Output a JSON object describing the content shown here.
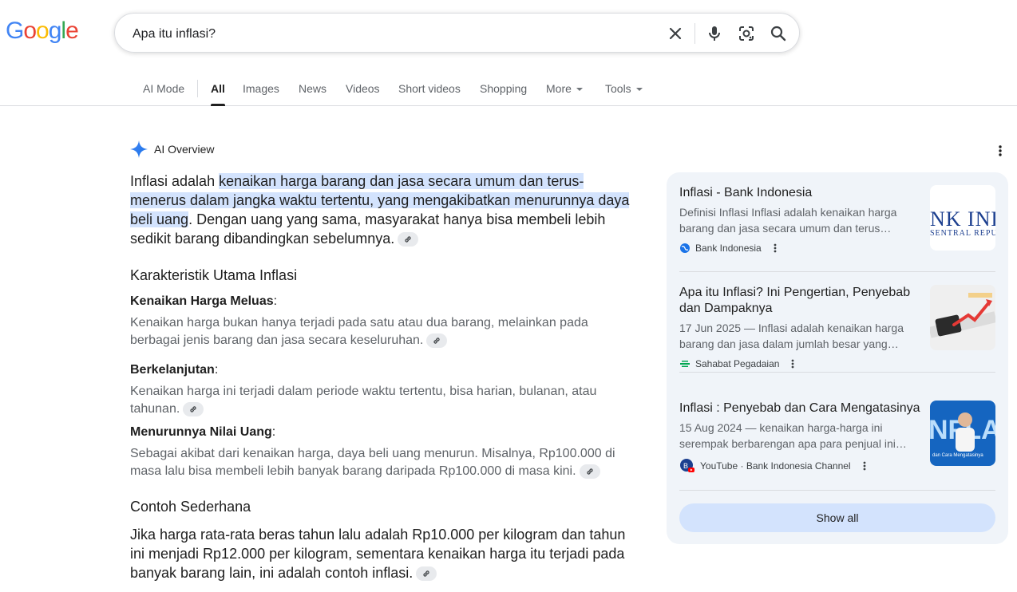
{
  "logo": {
    "letters": [
      "G",
      "o",
      "o",
      "g",
      "l",
      "e"
    ],
    "colors": [
      "#4285F4",
      "#EA4335",
      "#FBBC05",
      "#4285F4",
      "#34A853",
      "#EA4335"
    ]
  },
  "search": {
    "query": "Apa itu inflasi?"
  },
  "icons": {
    "clear": "close-icon",
    "voice": "mic-icon",
    "lens": "camera-lens-icon",
    "search": "search-icon"
  },
  "tabs": [
    {
      "label": "AI Mode"
    },
    {
      "label": "All",
      "active": true
    },
    {
      "label": "Images"
    },
    {
      "label": "News"
    },
    {
      "label": "Videos"
    },
    {
      "label": "Short videos"
    },
    {
      "label": "Shopping"
    },
    {
      "label": "More"
    },
    {
      "label": "Tools"
    }
  ],
  "ai_overview": {
    "title": "AI Overview",
    "intro": {
      "before": "Inflasi adalah ",
      "highlight": "kenaikan harga barang dan jasa secara umum dan terus-menerus dalam jangka waktu tertentu, yang mengakibatkan menurunnya daya beli uang",
      "after": ". Dengan uang yang sama, masyarakat hanya bisa membeli lebih sedikit barang dibandingkan sebelumnya."
    },
    "section1_heading": "Karakteristik Utama Inflasi",
    "items": [
      {
        "title": "Kenaikan Harga Meluas",
        "desc": "Kenaikan harga bukan hanya terjadi pada satu atau dua barang, melainkan pada berbagai jenis barang dan jasa secara keseluruhan."
      },
      {
        "title": "Berkelanjutan",
        "desc": "Kenaikan harga ini terjadi dalam periode waktu tertentu, bisa harian, bulanan, atau tahunan."
      },
      {
        "title": "Menurunnya Nilai Uang",
        "desc": "Sebagai akibat dari kenaikan harga, daya beli uang menurun. Misalnya, Rp100.000 di masa lalu bisa membeli lebih banyak barang daripada Rp100.000 di masa kini."
      }
    ],
    "section2_heading": "Contoh Sederhana",
    "example": "Jika harga rata-rata beras tahun lalu adalah Rp10.000 per kilogram dan tahun ini menjadi Rp12.000 per kilogram, sementara kenaikan harga itu terjadi pada banyak barang lain, ini adalah contoh inflasi."
  },
  "sources": [
    {
      "title": "Inflasi - Bank Indonesia",
      "snippet": "Definisi Inflasi Inflasi adalah kenaikan harga barang dan jasa secara umum dan terus…",
      "source": "Bank Indonesia",
      "thumb_text1": "NK IND",
      "thumb_text2": "SENTRAL REPU"
    },
    {
      "title": "Apa itu Inflasi? Ini Pengertian, Penyebab dan Dampaknya",
      "snippet": "17 Jun 2025 — Inflasi adalah kenaikan harga barang dan jasa dalam jumlah besar yang…",
      "source": "Sahabat Pegadaian"
    },
    {
      "title": "Inflasi : Penyebab dan Cara Mengatasinya",
      "snippet": "15 Aug 2024 — kenaikan harga-harga ini serempak berbarengan apa para penjual ini…",
      "source": "YouTube · Bank Indonesia Channel",
      "thumb_text1": "NFLAS",
      "thumb_text2": "dan Cara Mengatasinya"
    }
  ],
  "show_all": "Show all"
}
